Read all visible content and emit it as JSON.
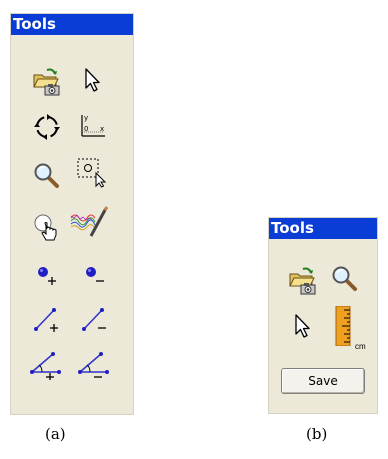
{
  "panel_a": {
    "title": "Tools",
    "tools": [
      {
        "icon": "open-folder-camera-icon"
      },
      {
        "icon": "arrow-pointer-icon"
      },
      {
        "icon": "rotate-arrows-icon"
      },
      {
        "icon": "axes-icon",
        "axis_labels": [
          "y",
          "0",
          "x"
        ]
      },
      {
        "icon": "magnifier-icon"
      },
      {
        "icon": "selection-rectangle-icon"
      },
      {
        "icon": "hand-pointer-icon"
      },
      {
        "icon": "spectrum-brush-icon"
      },
      {
        "icon": "add-point-icon"
      },
      {
        "icon": "remove-point-icon"
      },
      {
        "icon": "add-line-icon"
      },
      {
        "icon": "remove-line-icon"
      },
      {
        "icon": "add-angle-icon"
      },
      {
        "icon": "remove-angle-icon"
      }
    ]
  },
  "panel_b": {
    "title": "Tools",
    "tools": [
      {
        "icon": "open-folder-camera-icon"
      },
      {
        "icon": "magnifier-icon"
      },
      {
        "icon": "arrow-pointer-icon"
      },
      {
        "icon": "ruler-icon",
        "unit_label": "cm"
      }
    ],
    "save_label": "Save"
  },
  "captions": {
    "a": "(a)",
    "b": "(b)"
  },
  "colors": {
    "title_bar": "#0a3cd6",
    "panel_bg": "#ece9d8",
    "tool_blue": "#2b2bd6",
    "ruler": "#f0a020"
  }
}
